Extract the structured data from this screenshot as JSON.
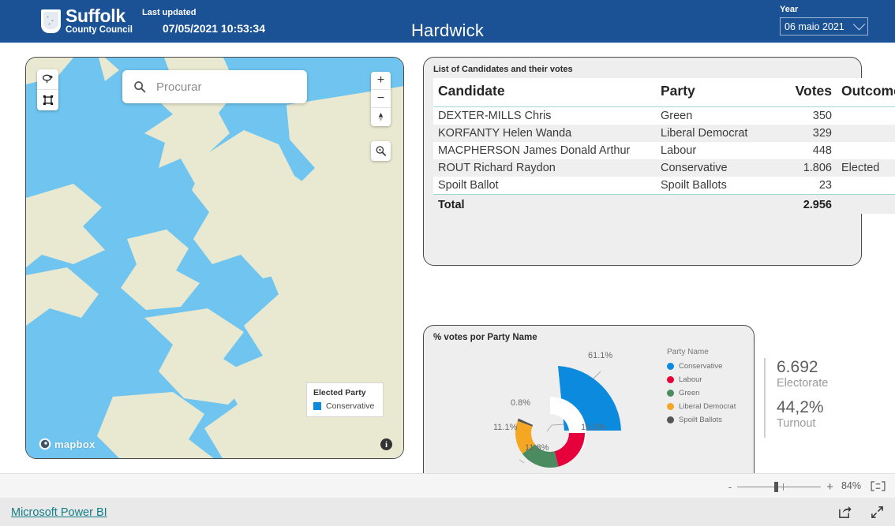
{
  "header": {
    "logo_title": "Suffolk",
    "logo_subtitle": "County Council",
    "last_updated_label": "Last updated",
    "last_updated_value": "07/05/2021 10:53:34",
    "page_title": "Hardwick",
    "year_label": "Year",
    "year_value": "06 maio 2021"
  },
  "map": {
    "search_placeholder": "Procurar",
    "search_value": "",
    "zoom_in": "+",
    "zoom_out": "−",
    "attribution": "mapbox",
    "info": "i",
    "legend": {
      "title": "Elected Party",
      "entries": [
        {
          "label": "Conservative",
          "color": "#0b8ade"
        }
      ]
    },
    "colors": {
      "water": "#6fc5ef",
      "land": "#e9e9d1"
    }
  },
  "table": {
    "title": "List of Candidates and their votes",
    "columns": [
      "Candidate",
      "Party",
      "Votes",
      "Outcome"
    ],
    "rows": [
      {
        "candidate": "DEXTER-MILLS Chris",
        "party": "Green",
        "votes": "350",
        "outcome": ""
      },
      {
        "candidate": "KORFANTY Helen Wanda",
        "party": "Liberal Democrat",
        "votes": "329",
        "outcome": ""
      },
      {
        "candidate": "MACPHERSON James Donald Arthur",
        "party": "Labour",
        "votes": "448",
        "outcome": ""
      },
      {
        "candidate": "ROUT Richard Raydon",
        "party": "Conservative",
        "votes": "1.806",
        "outcome": "Elected"
      },
      {
        "candidate": "Spoilt Ballot",
        "party": "Spoilt Ballots",
        "votes": "23",
        "outcome": ""
      }
    ],
    "total_label": "Total",
    "total_votes": "2.956"
  },
  "chart_data": {
    "type": "pie",
    "title": "% votes por Party Name",
    "legend_title": "Party Name",
    "legend_position": "right",
    "categories": [
      "Conservative",
      "Labour",
      "Green",
      "Liberal Democrat",
      "Spoilt Ballots"
    ],
    "values": [
      61.1,
      15.2,
      11.8,
      11.1,
      0.8
    ],
    "data_labels": [
      "61.1%",
      "15.2%",
      "11.8%",
      "11.1%",
      "0.8%"
    ],
    "colors": [
      "#0b8ade",
      "#e6003c",
      "#4a8c5f",
      "#f5a623",
      "#555555"
    ],
    "exploded_slice": "Conservative",
    "xlabel": "",
    "ylabel": ""
  },
  "kpi": {
    "electorate_value": "6.692",
    "electorate_label": "Electorate",
    "turnout_value": "44,2%",
    "turnout_label": "Turnout"
  },
  "statusbar": {
    "zoom_percent": "84%",
    "minus": "-",
    "plus": "+"
  },
  "footer": {
    "powerbi_link": "Microsoft Power BI"
  }
}
